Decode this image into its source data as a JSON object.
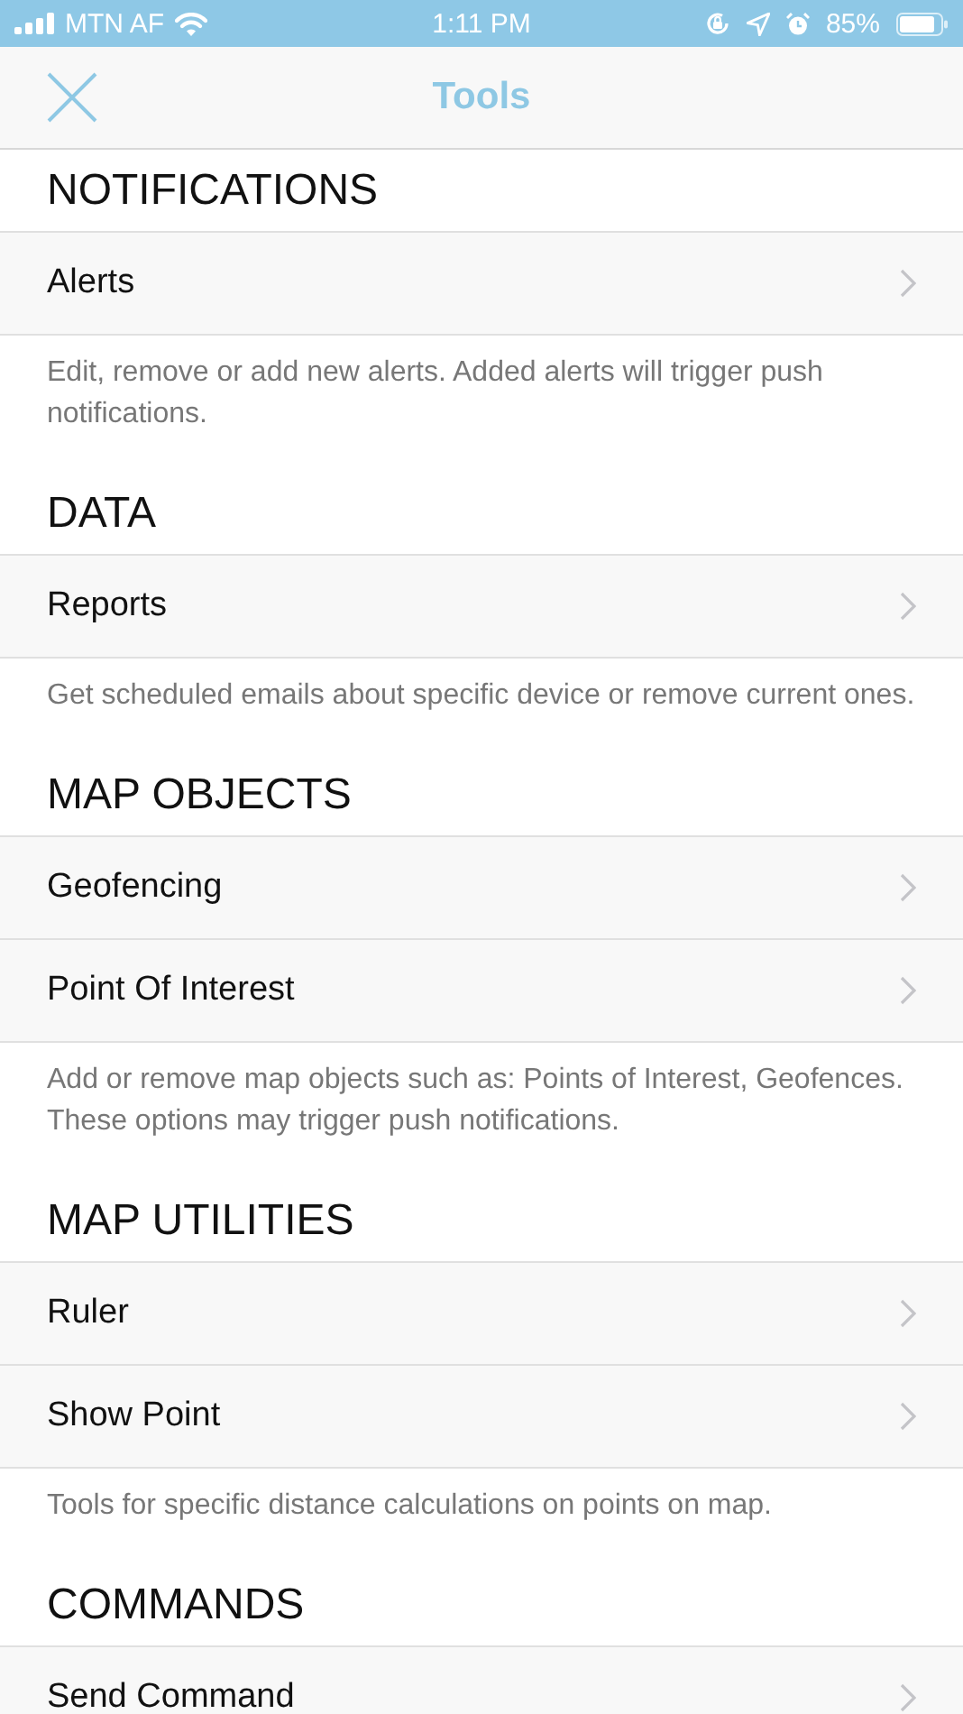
{
  "status_bar": {
    "carrier": "MTN AF",
    "time": "1:11 PM",
    "battery": "85%"
  },
  "nav_bar": {
    "title": "Tools"
  },
  "sections": [
    {
      "title": "NOTIFICATIONS",
      "items": [
        {
          "label": "Alerts"
        }
      ],
      "description": "Edit, remove or add new alerts. Added alerts will trigger push notifications."
    },
    {
      "title": "DATA",
      "items": [
        {
          "label": "Reports"
        }
      ],
      "description": "Get scheduled emails about specific device or remove current ones."
    },
    {
      "title": "MAP OBJECTS",
      "items": [
        {
          "label": "Geofencing"
        },
        {
          "label": "Point Of Interest"
        }
      ],
      "description": "Add or remove map objects such as: Points of Interest, Geofences. These options may trigger push notifications."
    },
    {
      "title": "MAP UTILITIES",
      "items": [
        {
          "label": "Ruler"
        },
        {
          "label": "Show Point"
        }
      ],
      "description": "Tools for specific distance calculations on points on map."
    },
    {
      "title": "COMMANDS",
      "items": [
        {
          "label": "Send Command"
        }
      ]
    }
  ]
}
